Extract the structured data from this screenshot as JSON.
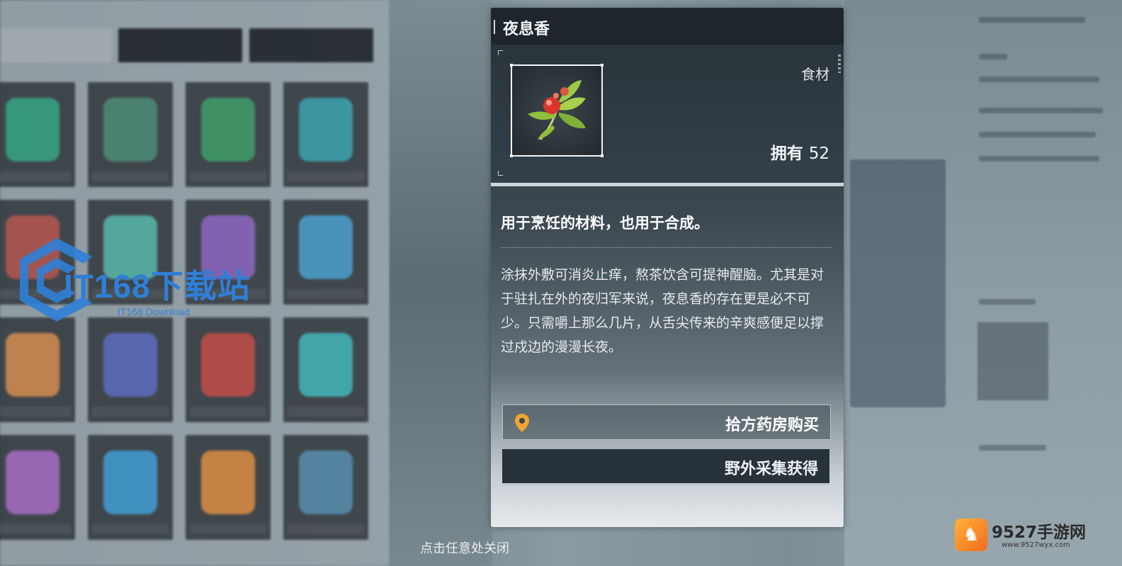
{
  "dialog": {
    "title": "夜息香",
    "category": "食材",
    "owned_label": "拥有",
    "owned_count": "52",
    "short_description": "用于烹饪的材料，也用于合成。",
    "long_description": "涂抹外敷可消炎止痒，熬茶饮含可提神醒脑。尤其是对于驻扎在外的夜归军来说，夜息香的存在更是必不可少。只需嚼上那么几片，从舌尖传来的辛爽感便足以撑过戍边的漫漫长夜。",
    "icon": "red-berry-herb-sprig",
    "sources": [
      {
        "label": "拾方药房购买",
        "icon": "location-pin-icon"
      },
      {
        "label": "野外采集获得"
      }
    ]
  },
  "close_hint": "点击任意处关闭",
  "watermarks": {
    "it168_title": "IT168下载站",
    "it168_sub": "IT168 Download",
    "site_name": "9527手游网",
    "site_url": "www.9527wyx.com"
  },
  "colors": {
    "dialog_header": "#1e262c",
    "pin": "#f0a531",
    "watermark_blue": "#2f7fd8",
    "logo_orange": "#f26b1d"
  }
}
